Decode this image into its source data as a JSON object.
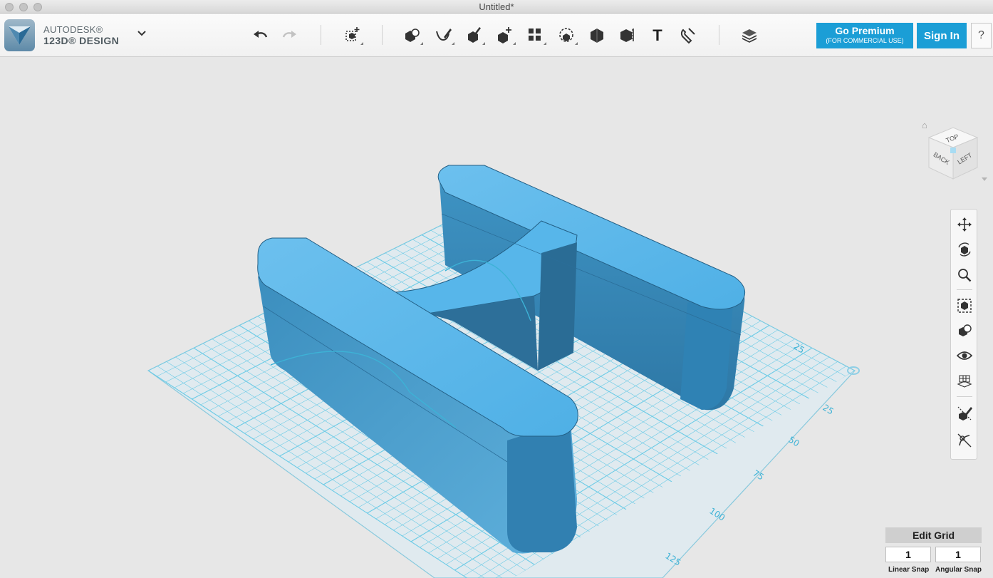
{
  "window": {
    "title": "Untitled*"
  },
  "brand": {
    "line1": "AUTODESK®",
    "line2": "123D® DESIGN"
  },
  "toolbar": {
    "tools": [
      "undo-icon",
      "redo-icon",
      "transform-icon",
      "primitives-icon",
      "sketch-icon",
      "construct-icon",
      "modify-icon",
      "pattern-icon",
      "group-icon",
      "combine-icon",
      "measure-icon",
      "text-icon",
      "snap-icon",
      "material-icon"
    ],
    "text_tool_label": "T"
  },
  "premium": {
    "label": "Go Premium",
    "sublabel": "(FOR COMMERCIAL USE)"
  },
  "signin": {
    "label": "Sign In"
  },
  "help": {
    "label": "?"
  },
  "viewcube": {
    "top": "TOP",
    "back": "BACK",
    "left": "LEFT"
  },
  "grid": {
    "labels": [
      "25",
      "25",
      "50",
      "75",
      "100",
      "125"
    ]
  },
  "navbar": {
    "items": [
      "pan-icon",
      "orbit-icon",
      "zoom-icon",
      "fit-icon",
      "materials-outlines-icon",
      "visibility-icon",
      "grid-view-icon",
      "hide-sketch-icon",
      "hide-mesh-icon"
    ]
  },
  "edit_grid": {
    "label": "Edit Grid",
    "linear_snap_value": "1",
    "angular_snap_value": "1",
    "linear_snap_label": "Linear Snap",
    "angular_snap_label": "Angular Snap"
  },
  "colors": {
    "accent": "#1b9ed6",
    "model": "#4eaee2",
    "grid": "#3db2d6"
  }
}
